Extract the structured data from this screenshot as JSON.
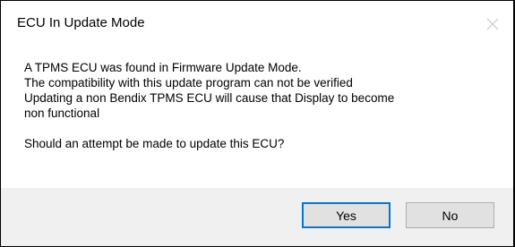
{
  "window": {
    "title": "ECU In Update Mode",
    "close_icon": "close-icon"
  },
  "message": {
    "lines": [
      "A TPMS ECU was found in Firmware Update Mode.",
      "The compatibility with this update program can not be verified",
      "Updating a non Bendix TPMS ECU will cause that Display to become",
      "non functional"
    ],
    "question": "Should an attempt be made to update this ECU?"
  },
  "buttons": {
    "yes_label": "Yes",
    "no_label": "No"
  },
  "colors": {
    "footer_bg": "#f0f0f0",
    "button_bg": "#e1e1e1",
    "default_button_border": "#0078d7"
  }
}
